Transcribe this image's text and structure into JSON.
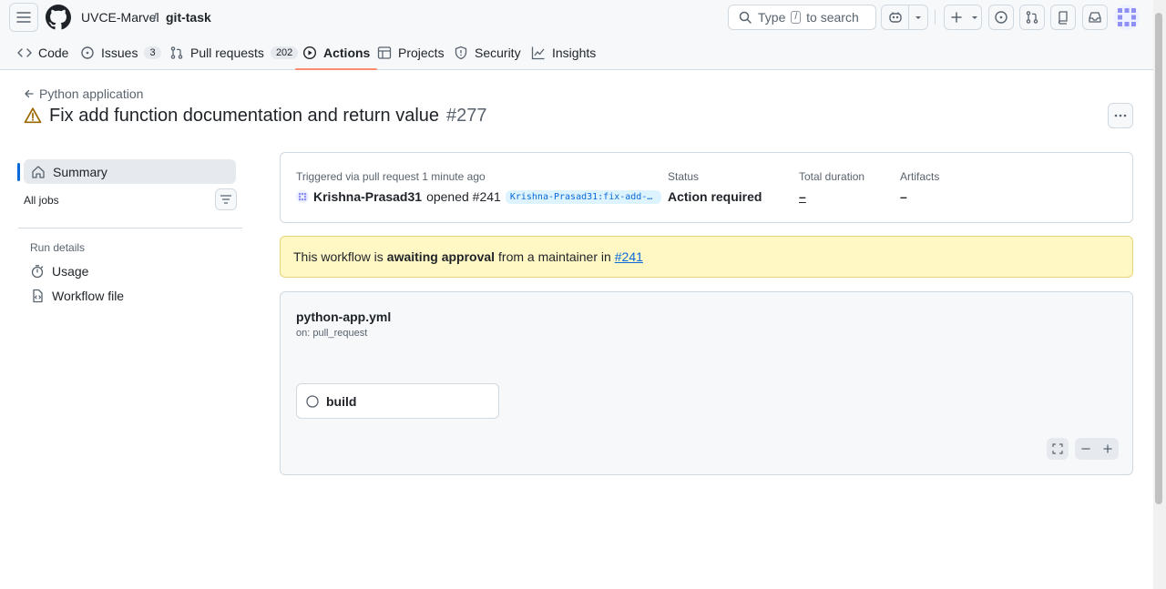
{
  "header": {
    "org": "UVCE-Marvel",
    "separator": "/",
    "repo": "git-task",
    "search_prefix": "Type",
    "search_key": "/",
    "search_suffix": "to search"
  },
  "tabs": [
    {
      "label": "Code",
      "icon": "code-icon"
    },
    {
      "label": "Issues",
      "count": "3",
      "icon": "issue-icon"
    },
    {
      "label": "Pull requests",
      "count": "202",
      "icon": "pull-request-icon"
    },
    {
      "label": "Actions",
      "icon": "play-icon",
      "active": true
    },
    {
      "label": "Projects",
      "icon": "table-icon"
    },
    {
      "label": "Security",
      "icon": "shield-icon"
    },
    {
      "label": "Insights",
      "icon": "graph-icon"
    }
  ],
  "page": {
    "back_label": "Python application",
    "title": "Fix add function documentation and return value",
    "run_number": "#277"
  },
  "sidebar": {
    "summary": "Summary",
    "all_jobs": "All jobs",
    "run_details": "Run details",
    "usage": "Usage",
    "workflow_file": "Workflow file"
  },
  "summary": {
    "triggered": "Triggered via pull request 1 minute ago",
    "user": "Krishna-Prasad31",
    "action": "opened #241",
    "branch": "Krishna-Prasad31:fix-add-fu…",
    "status_label": "Status",
    "status_value": "Action required",
    "duration_label": "Total duration",
    "duration_value": "–",
    "artifacts_label": "Artifacts",
    "artifacts_value": "–"
  },
  "flash": {
    "prefix": "This workflow is",
    "bold": "awaiting approval",
    "suffix": "from a maintainer in",
    "link": "#241"
  },
  "workflow": {
    "name": "python-app.yml",
    "trigger": "on: pull_request",
    "job": "build"
  },
  "colors": {
    "accent": "#0969da",
    "tab_underline": "#fd8c73",
    "warning": "#9a6700",
    "flash_bg": "#fff8c5"
  }
}
